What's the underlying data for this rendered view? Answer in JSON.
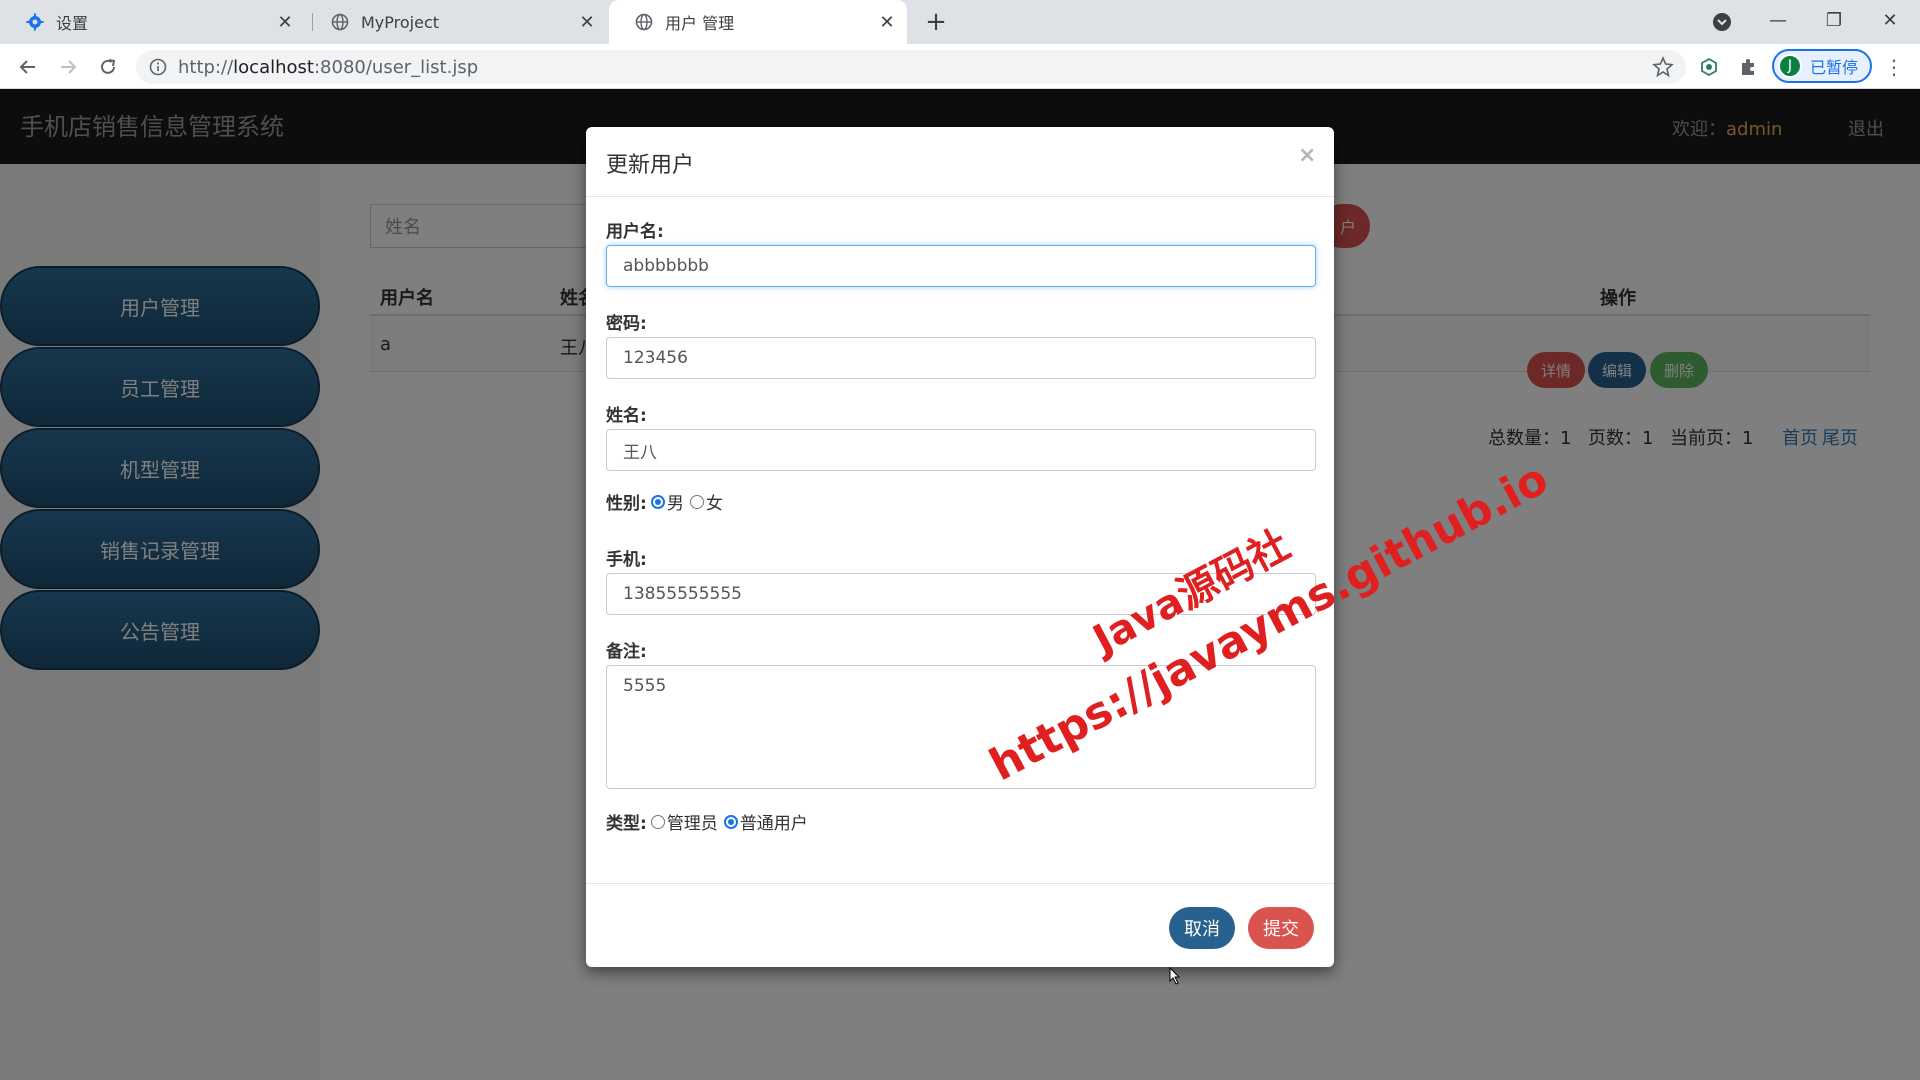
{
  "browser": {
    "tabs": [
      {
        "label": "设置",
        "icon": "gear-icon",
        "active": false
      },
      {
        "label": "MyProject",
        "icon": "globe-icon",
        "active": false
      },
      {
        "label": "用户 管理",
        "icon": "globe-icon",
        "active": true
      }
    ],
    "url_prefix": "http://",
    "url_host": "localhost",
    "url_rest": ":8080/user_list.jsp",
    "profile_initial": "J",
    "profile_label": "已暂停"
  },
  "app": {
    "title": "手机店销售信息管理系统",
    "welcome_label": "欢迎：",
    "username": "admin",
    "logout_label": "退出",
    "sidebar": [
      {
        "label": "用户管理"
      },
      {
        "label": "员工管理"
      },
      {
        "label": "机型管理"
      },
      {
        "label": "销售记录管理"
      },
      {
        "label": "公告管理"
      }
    ],
    "search_placeholder": "姓名",
    "add_button_label": "户",
    "table": {
      "headers": [
        "用户名",
        "姓名",
        "操作"
      ],
      "row": {
        "username": "a",
        "name": "王八"
      },
      "actions": [
        "详情",
        "编辑",
        "删除"
      ]
    },
    "pager": {
      "total": "总数量：1",
      "pages": "页数：1",
      "current": "当前页：1",
      "first": "首页",
      "last": "尾页"
    }
  },
  "modal": {
    "title": "更新用户",
    "close": "×",
    "fields": {
      "username": {
        "label": "用户名:",
        "value": "abbbbbbb"
      },
      "password": {
        "label": "密码:",
        "value": "123456"
      },
      "name": {
        "label": "姓名:",
        "value": "王八"
      },
      "gender": {
        "label": "性别:",
        "options": [
          "男",
          "女"
        ],
        "selected": "男"
      },
      "phone": {
        "label": "手机:",
        "value": "13855555555"
      },
      "remark": {
        "label": "备注:",
        "value": "5555"
      },
      "type": {
        "label": "类型:",
        "options": [
          "管理员",
          "普通用户"
        ],
        "selected": "普通用户"
      }
    },
    "cancel_label": "取消",
    "submit_label": "提交"
  },
  "watermark": {
    "line1": "Java源码社",
    "line2": "https://javayms.github.io",
    "color": "#e02020"
  },
  "colors": {
    "primary": "#286090",
    "danger": "#d9534f",
    "success": "#5cb85c",
    "header_bg": "#1b1b1b"
  }
}
